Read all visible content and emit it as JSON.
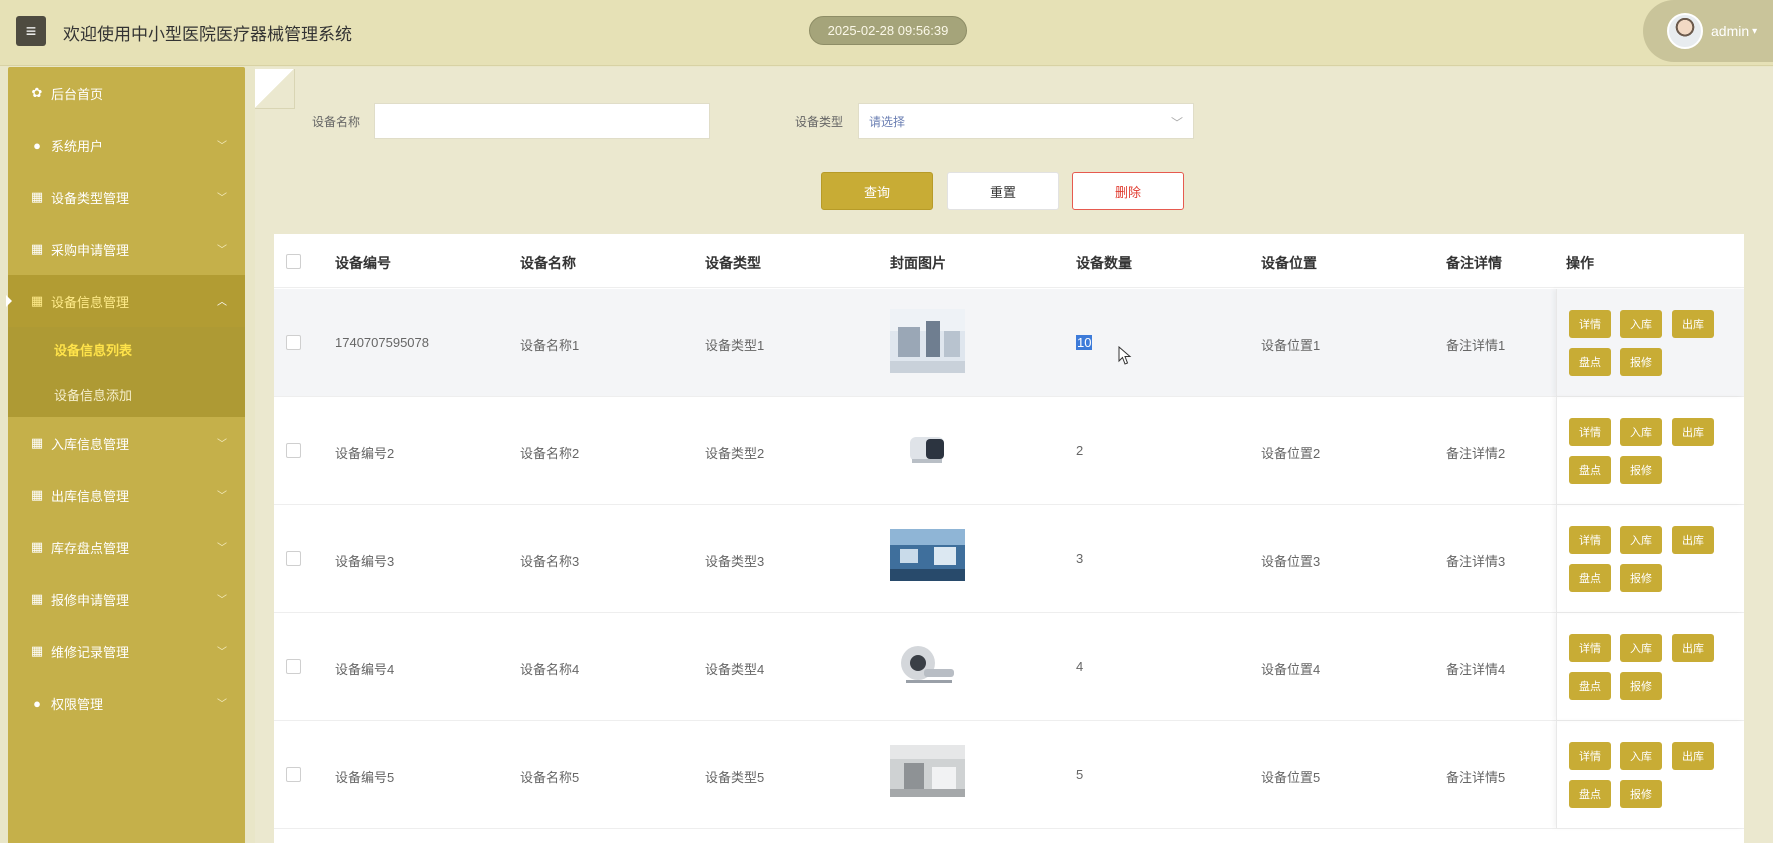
{
  "header": {
    "title": "欢迎使用中小型医院医疗器械管理系统",
    "datetime": "2025-02-28 09:56:39",
    "user": "admin"
  },
  "sidebar": {
    "items": [
      {
        "label": "后台首页",
        "icon": "home-icon"
      },
      {
        "label": "系统用户",
        "icon": "user-icon"
      },
      {
        "label": "设备类型管理",
        "icon": "grid-icon"
      },
      {
        "label": "采购申请管理",
        "icon": "grid-icon"
      },
      {
        "label": "设备信息管理",
        "icon": "grid-icon",
        "open": true
      },
      {
        "label": "入库信息管理",
        "icon": "grid-icon"
      },
      {
        "label": "出库信息管理",
        "icon": "grid-icon"
      },
      {
        "label": "库存盘点管理",
        "icon": "grid-icon"
      },
      {
        "label": "报修申请管理",
        "icon": "grid-icon"
      },
      {
        "label": "维修记录管理",
        "icon": "grid-icon"
      },
      {
        "label": "权限管理",
        "icon": "user-icon"
      }
    ],
    "sub_items": [
      "设备信息列表",
      "设备信息添加"
    ]
  },
  "search": {
    "name_label": "设备名称",
    "name_value": "",
    "type_label": "设备类型",
    "type_placeholder": "请选择"
  },
  "buttons": {
    "query": "查询",
    "reset": "重置",
    "delete": "删除"
  },
  "table": {
    "columns": [
      "设备编号",
      "设备名称",
      "设备类型",
      "封面图片",
      "设备数量",
      "设备位置",
      "备注详情",
      "操作"
    ],
    "rows": [
      {
        "code": "1740707595078",
        "name": "设备名称1",
        "type": "设备类型1",
        "qty": "10",
        "location": "设备位置1",
        "note": "备注详情1"
      },
      {
        "code": "设备编号2",
        "name": "设备名称2",
        "type": "设备类型2",
        "qty": "2",
        "location": "设备位置2",
        "note": "备注详情2"
      },
      {
        "code": "设备编号3",
        "name": "设备名称3",
        "type": "设备类型3",
        "qty": "3",
        "location": "设备位置3",
        "note": "备注详情3"
      },
      {
        "code": "设备编号4",
        "name": "设备名称4",
        "type": "设备类型4",
        "qty": "4",
        "location": "设备位置4",
        "note": "备注详情4"
      },
      {
        "code": "设备编号5",
        "name": "设备名称5",
        "type": "设备类型5",
        "qty": "5",
        "location": "设备位置5",
        "note": "备注详情5"
      }
    ],
    "actions": [
      "详情",
      "入库",
      "出库",
      "盘点",
      "报修"
    ]
  },
  "colors": {
    "accent": "#c8ac35",
    "sidebar": "#c5b04a",
    "danger": "#e03b2f"
  }
}
